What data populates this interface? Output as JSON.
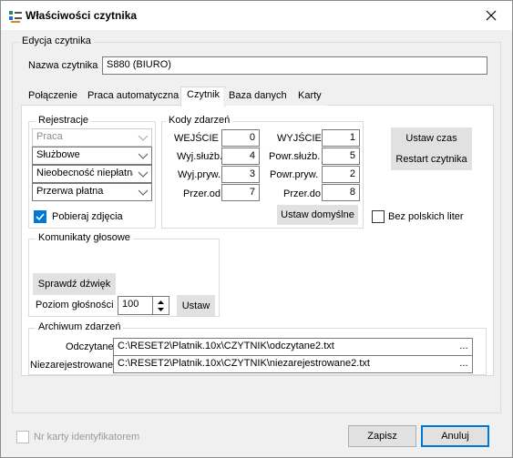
{
  "window": {
    "title": "Właściwości czytnika"
  },
  "edycja": {
    "group_label": "Edycja czytnika",
    "name_label": "Nazwa czytnika",
    "name_value": "S880 (BIURO)"
  },
  "tabs": [
    {
      "label": "Połączenie"
    },
    {
      "label": "Praca automatyczna"
    },
    {
      "label": "Czytnik"
    },
    {
      "label": "Baza danych"
    },
    {
      "label": "Karty"
    }
  ],
  "rejestracje": {
    "label": "Rejestracje",
    "combos": [
      "Praca",
      "Służbowe",
      "Nieobecność niepłatna",
      "Przerwa płatna"
    ],
    "photo_checkbox": "Pobieraj zdjęcia"
  },
  "kody": {
    "label": "Kody zdarzeń",
    "left": [
      {
        "label": "WEJŚCIE",
        "value": "0"
      },
      {
        "label": "Wyj.służb.",
        "value": "4"
      },
      {
        "label": "Wyj.pryw.",
        "value": "3"
      },
      {
        "label": "Przer.od",
        "value": "7"
      }
    ],
    "right": [
      {
        "label": "WYJŚCIE",
        "value": "1"
      },
      {
        "label": "Powr.służb.",
        "value": "5"
      },
      {
        "label": "Powr.pryw.",
        "value": "2"
      },
      {
        "label": "Przer.do",
        "value": "8"
      }
    ],
    "default_button": "Ustaw domyślne"
  },
  "actions": {
    "set_time": "Ustaw czas",
    "restart": "Restart czytnika"
  },
  "no_polish": "Bez polskich liter",
  "komunikaty": {
    "label": "Komunikaty głosowe",
    "check_sound": "Sprawdź dźwięk",
    "volume_label": "Poziom głośności",
    "volume_value": "100",
    "set_button": "Ustaw"
  },
  "archiwum": {
    "label": "Archiwum zdarzeń",
    "read_label": "Odczytane",
    "read_path": "C:\\RESET2\\Platnik.10x\\CZYTNIK\\odczytane2.txt",
    "unreg_label": "Niezarejestrowane",
    "unreg_path": "C:\\RESET2\\Platnik.10x\\CZYTNIK\\niezarejestrowane2.txt",
    "browse": "..."
  },
  "footer": {
    "card_checkbox": "Nr karty identyfikatorem",
    "save": "Zapisz",
    "cancel": "Anuluj"
  },
  "colors": {
    "accent": "#0078d7",
    "panel": "#ffffff",
    "window": "#f0f0f0"
  }
}
